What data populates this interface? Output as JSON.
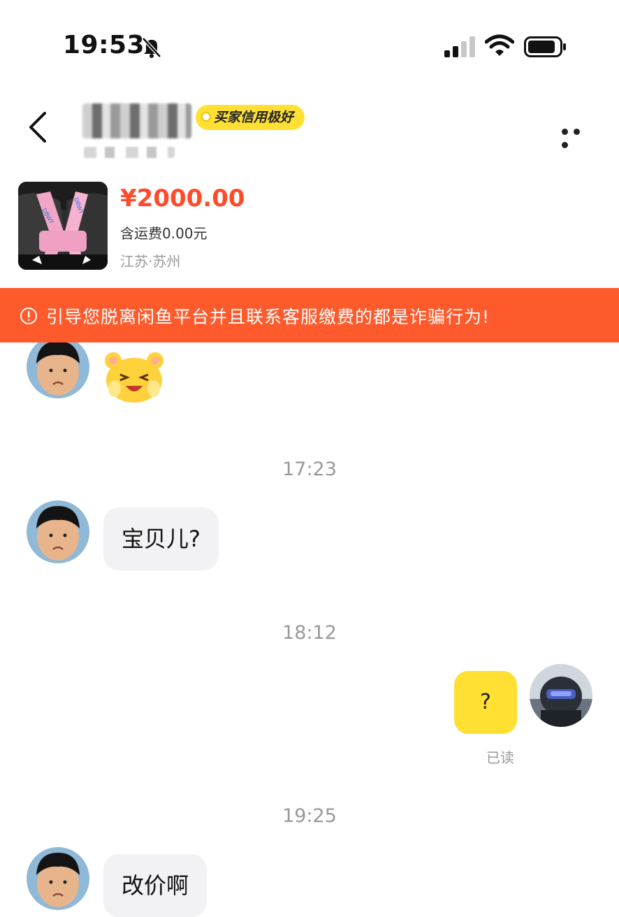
{
  "status_bar": {
    "time": "19:53",
    "icons": [
      "bell-slash-icon",
      "cellular-signal-icon",
      "wifi-icon",
      "battery-icon"
    ]
  },
  "header": {
    "credit_badge": "买家信用极好",
    "back_icon": "chevron-left-icon",
    "more_icon": "ellipsis-icon"
  },
  "product": {
    "price": "¥2000.00",
    "shipping": "含运费0.00元",
    "location": "江苏·苏州"
  },
  "warning": {
    "text": "引导您脱离闲鱼平台并且联系客服缴费的都是诈骗行为!",
    "icon": "info-circle-icon"
  },
  "chat": {
    "messages": [
      {
        "type": "sticker",
        "side": "left",
        "sticker": "laughing-hamster-sticker"
      },
      {
        "type": "time",
        "text": "17:23"
      },
      {
        "type": "text",
        "side": "left",
        "text": "宝贝儿?"
      },
      {
        "type": "time",
        "text": "18:12"
      },
      {
        "type": "text",
        "side": "right",
        "text": "?",
        "status": "已读"
      },
      {
        "type": "time",
        "text": "19:25"
      },
      {
        "type": "text",
        "side": "left",
        "text": "改价啊"
      }
    ]
  },
  "colors": {
    "accent_yellow": "#ffe033",
    "price_red": "#ff4b2b",
    "warning_orange": "#ff5a2c",
    "bubble_gray": "#f2f2f4"
  }
}
